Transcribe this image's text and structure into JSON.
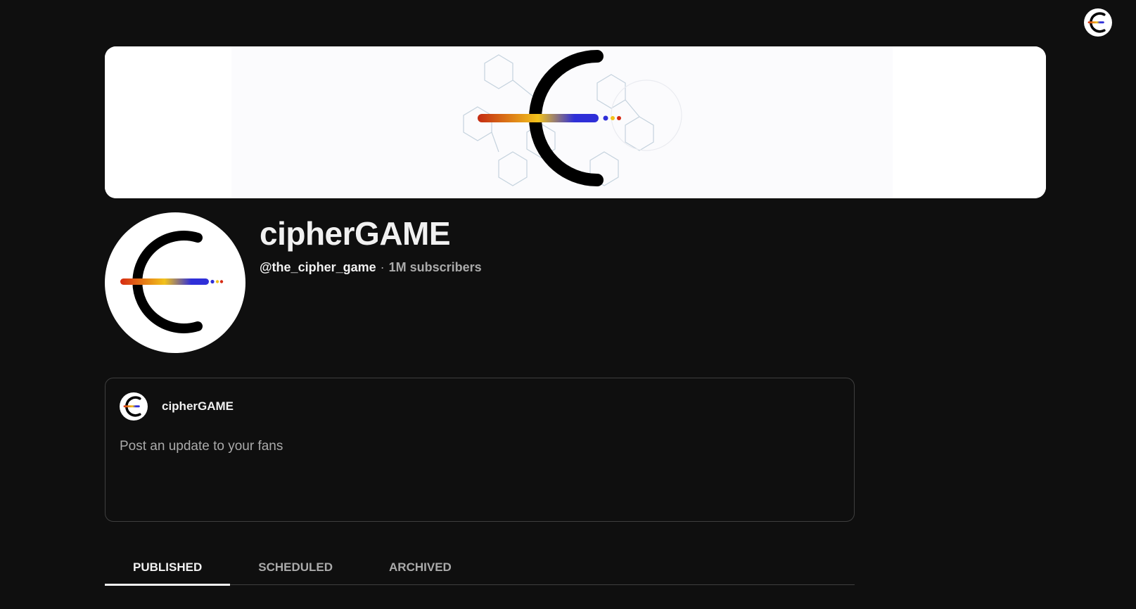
{
  "account": {
    "avatar_icon": "cipher-logo-icon"
  },
  "banner": {
    "icon": "cipher-logo-icon"
  },
  "channel": {
    "name": "cipherGAME",
    "handle": "@the_cipher_game",
    "separator": "·",
    "subscribers": "1M subscribers",
    "avatar_icon": "cipher-logo-icon"
  },
  "composer": {
    "author": "cipherGAME",
    "placeholder": "Post an update to your fans",
    "avatar_icon": "cipher-logo-icon"
  },
  "tabs": [
    {
      "label": "PUBLISHED",
      "active": true
    },
    {
      "label": "SCHEDULED",
      "active": false
    },
    {
      "label": "ARCHIVED",
      "active": false
    }
  ],
  "colors": {
    "background": "#0f0f0f",
    "text_primary": "#f1f1f1",
    "text_secondary": "#aaaaaa",
    "border": "#3f3f3f",
    "logo_red": "#d62a12",
    "logo_yellow": "#f2c21b",
    "logo_blue": "#2f2fd8"
  }
}
